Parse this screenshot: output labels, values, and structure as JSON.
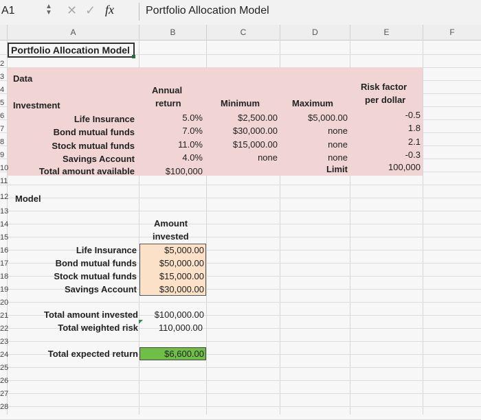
{
  "formula_bar": {
    "cell_ref": "A1",
    "fx": "fx",
    "formula": "Portfolio Allocation Model"
  },
  "columns": [
    "A",
    "B",
    "C",
    "D",
    "E",
    "F"
  ],
  "rows": [
    "2",
    "3",
    "4",
    "5",
    "6",
    "7",
    "8",
    "9",
    "10",
    "11",
    "12",
    "13",
    "14",
    "15",
    "16",
    "17",
    "18",
    "19",
    "20",
    "21",
    "22",
    "23",
    "24",
    "25",
    "26",
    "27",
    "28"
  ],
  "title": "Portfolio Allocation Model",
  "data_section": {
    "label": "Data",
    "investment_label": "Investment",
    "annual_return_header": [
      "Annual",
      "return"
    ],
    "minimum_header": "Minimum",
    "maximum_header": "Maximum",
    "risk_header": [
      "Risk factor",
      "per dollar"
    ],
    "rows": [
      {
        "name": "Life Insurance",
        "return": "5.0%",
        "min": "$2,500.00",
        "max": "$5,000.00",
        "risk": "-0.5"
      },
      {
        "name": "Bond mutual funds",
        "return": "7.0%",
        "min": "$30,000.00",
        "max": "none",
        "risk": "1.8"
      },
      {
        "name": "Stock mutual funds",
        "return": "11.0%",
        "min": "$15,000.00",
        "max": "none",
        "risk": "2.1"
      },
      {
        "name": "Savings Account",
        "return": "4.0%",
        "min": "none",
        "max": "none",
        "risk": "-0.3"
      }
    ],
    "total_label": "Total amount available",
    "total_value": "$100,000",
    "limit_label": "Limit",
    "limit_value": "100,000"
  },
  "model_section": {
    "label": "Model",
    "amount_header": [
      "Amount",
      "invested"
    ],
    "rows": [
      {
        "name": "Life Insurance",
        "amount": "$5,000.00"
      },
      {
        "name": "Bond mutual funds",
        "amount": "$50,000.00"
      },
      {
        "name": "Stock mutual funds",
        "amount": "$15,000.00"
      },
      {
        "name": "Savings Account",
        "amount": "$30,000.00"
      }
    ],
    "total_invested_label": "Total amount invested",
    "total_invested_value": "$100,000.00",
    "weighted_risk_label": "Total weighted risk",
    "weighted_risk_value": "110,000.00",
    "expected_return_label": "Total expected return",
    "expected_return_value": "$6,600.00"
  },
  "colors": {
    "data_fill": "#f1d4d4",
    "input_fill": "#fbe1c7",
    "result_fill": "#6fbf47"
  }
}
